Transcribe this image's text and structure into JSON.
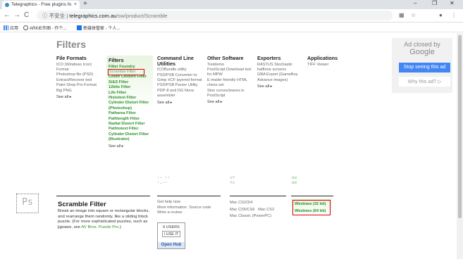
{
  "browser": {
    "tab_title": "Telegraphics - Free plugins fo",
    "tab_close": "×",
    "new_tab": "+",
    "win_min": "–",
    "win_max": "❐",
    "win_close": "✕",
    "back": "←",
    "forward": "→",
    "reload": "C",
    "security_label": "ⓘ 不安全",
    "url_host": "telegraphics.com.au",
    "url_path": "/sw/product/Scramble",
    "translate_icon": "▦",
    "star_icon": "☆",
    "profile_icon": "●",
    "menu_icon": "⋮"
  },
  "bookmarks": {
    "apps": "应用",
    "item1": "ARKIE作图 - 作个...",
    "item2": "新媒体管家 - 个人..."
  },
  "page": {
    "heading": "Filters",
    "columns": [
      {
        "title": "File Formats",
        "items": [
          "ICO (Windows Icon) Format",
          "Photoshop file (PSD) Extract/Recover tool",
          "Paint Shop Pro Format",
          "Big PNG"
        ],
        "see_all": "See all ▸"
      },
      {
        "title": "Filters",
        "items": [
          "Filter Foundry",
          "Scramble Filter",
          "Count Colours Filter",
          "S/&S Filter",
          "12bits Filter",
          "Life Filter",
          "Histotest Filter",
          "Cylinder Distort Filter (Photoshop)",
          "Patharea Filter",
          "Pathlength Filter",
          "Radial Distort Filter",
          "Pathtotext Filter",
          "Cylinder Distort Filter (Illustrator)"
        ],
        "see_all": "See all ▸"
      },
      {
        "title": "Command Line Utilities",
        "items": [
          "ICOBundle utility",
          "PSD/PSB Converter to Gimp XCF layered format",
          "PSD/PSB Parser Utility",
          "PDP-8 and DG Nova assembler"
        ],
        "see_all": "See all ▸"
      },
      {
        "title": "Other Software",
        "items": [
          "Tooldemo",
          "PostScript Download tool for MPW",
          "E-mailer friendly HTML chess set",
          "Sine curves/waves in PostScript"
        ],
        "see_all": "See all ▸"
      },
      {
        "title": "Exporters",
        "items": [
          "RASTUS Stochastic halftone screens",
          "GBA Export (GameBoy Advance images)"
        ],
        "see_all": "See all ▸"
      },
      {
        "title": "Applications",
        "items": [
          "TIFF Viewer"
        ],
        "see_all": ""
      }
    ],
    "ad": {
      "closed_by": "Ad closed by",
      "google": "Google",
      "stop": "Stop seeing this ad",
      "why": "Why this ad? ▷"
    },
    "glyphs": {
      "g1": "·· ··\n·.··",
      "g2": "∴∵\n∵∴",
      "g3": "▫▫\n▫▫"
    },
    "product": {
      "logo_text": "Ps",
      "title": "Scramble Filter",
      "desc_pre": "Break an image into square or rectangular blocks, and rearrange them randomly, like a sliding block puzzle. (For more sophisticated puzzles, such as jigsaws, see ",
      "desc_link": "AV Bros. Puzzle Pro",
      "desc_post": ".)",
      "help": "Get help now",
      "more_info": "More information",
      "source_code": "Source code",
      "write_review": "Write a review",
      "users_count": "6 USERS",
      "use_it": "I USE IT",
      "open_hub": "Open Hub",
      "mac1": "Mac CS2/3/4",
      "mac2": "Mac CS5/CS6",
      "mac3": "Mac CS2",
      "mac4": "Mac Classic (PowerPC)",
      "win32": "Windows (32 bit)",
      "win64": "Windows (64 bit)"
    }
  }
}
